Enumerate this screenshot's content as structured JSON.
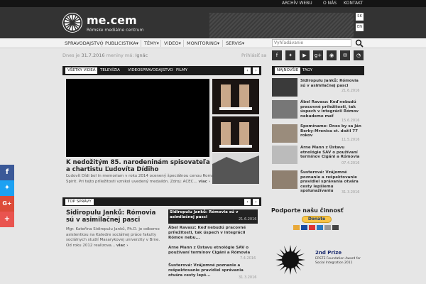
{
  "util": {
    "archive": "ARCHÍV WEBU",
    "about": "O NÁS",
    "contact": "KONTAKT"
  },
  "brand": {
    "name": "me.cem",
    "subtitle": "Rómske mediálne centrum"
  },
  "lang": {
    "sk": "SK",
    "en": "EN"
  },
  "nav": {
    "items": [
      "SPRAVODAJSTVO",
      "PUBLICISTIKA▾",
      "TÉMY▾",
      "VIDEO▾",
      "MONITORING▾",
      "SERVIS▾"
    ],
    "search_placeholder": "Vyhľadávanie"
  },
  "dateline": {
    "prefix": "Dnes je",
    "date": "31.7.2016",
    "middle": "meniny má:",
    "name": "Ignác",
    "login": "Prihlásiť sa"
  },
  "video": {
    "tabs": [
      "VŠETKY VIDEÁ",
      "TELEVÍZIA",
      "VIDEOSPRAVODAJSTVO",
      "FILMY"
    ],
    "title": "K nedožitým 85. narodeninám spisovateľa a chartistu Ľudovíta Dídiho",
    "desc": "Ľudovít Dídi bol in memoriam v roku 2014 ocenený špeciálnou cenou Roma Spirit. Pri tejto príležitosti vznikol uvedený medailón. Zdroj: ACEC...",
    "more": "viac ›"
  },
  "top": {
    "label": "TOP SPRÁVY",
    "lead_title": "Sidiropulu Janků: Rómovia sú v asimilačnej pasci",
    "lead_desc": "Mgr. Kateřina Sidiropulu Janků, Ph.D. je odborno asistentkou na Katedre sociálnej práce fakulty sociálnych studií Masarykovej univerzity v Brne. Od roku 2012 realizova...",
    "more": "viac ›",
    "items": [
      {
        "title": "Sidiropulu Janků: Rómovia sú v asimilačnej pasci",
        "date": "21.6.2016"
      },
      {
        "title": "Ábel Ravasz: Keď nebudú pracovné príležitosti, tak úspech v integrácii Rómov nebu...",
        "date": ""
      },
      {
        "title": "Arne Mann z Ústavu etnológie SAV o používaní termínov Cigáni a Rómovia",
        "date": "7.4.2016"
      },
      {
        "title": "Šusterová: Vzájomné poznanie a rešpektovanie pravidiel správania otvára cesty lepš...",
        "date": "31.3.2016"
      }
    ]
  },
  "right": {
    "tabs": [
      "NAJNOVŠIE",
      "TAGY"
    ],
    "items": [
      {
        "title": "Sidiropulu Janků: Rómovia sú v asimilačnej pasci",
        "date": "21.6.2016"
      },
      {
        "title": "Ábel Ravasz: Keď nebudú pracovné príležitosti, tak úspech v integrácii Rómov nebudeme mať",
        "date": "15.6.2016"
      },
      {
        "title": "Spomíname: Dnes by sa Ján Berky-Mrenica st. dožil 77 rokov",
        "date": "11.5.2016"
      },
      {
        "title": "Arne Mann z Ústavu etnológie SAV o používaní termínov Cigáni a Rómovia",
        "date": "07.4.2016"
      },
      {
        "title": "Šusterová: Vzájomné poznanie a rešpektovanie pravidiel správania otvára cesty lepšiemu spolunažívaniu",
        "date": "31.3.2016"
      }
    ],
    "support": "Podporte našu činnosť",
    "donate": "Donate",
    "prize_title": "2nd Prize",
    "prize_sub": "ERSTE Foundation Award for Social Integration 2011"
  },
  "colors": {
    "dark": "#1c1c1c",
    "header": "#333333",
    "facebook": "#3b5998",
    "twitter": "#1da1f2",
    "google": "#dd4b39",
    "plus": "#e9544f"
  }
}
